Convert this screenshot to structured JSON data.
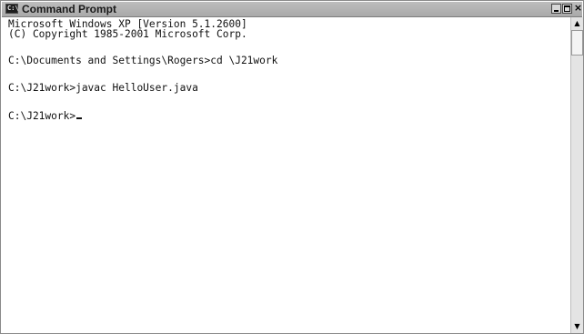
{
  "window": {
    "title": "Command Prompt",
    "icon": "C:\\",
    "controls": {
      "minimize": "minimize-icon",
      "maximize": "maximize-icon",
      "close": "×"
    }
  },
  "console": {
    "lines": [
      "Microsoft Windows XP [Version 5.1.2600]",
      "(C) Copyright 1985-2001 Microsoft Corp.",
      "",
      "C:\\Documents and Settings\\Rogers>cd \\J21work",
      "",
      "C:\\J21work>javac HelloUser.java",
      "",
      "C:\\J21work>"
    ]
  },
  "scrollbar": {
    "up": "▲",
    "down": "▼"
  },
  "colors": {
    "titlebar": "#b3b3b3",
    "background": "#ffffff",
    "text": "#111111"
  }
}
